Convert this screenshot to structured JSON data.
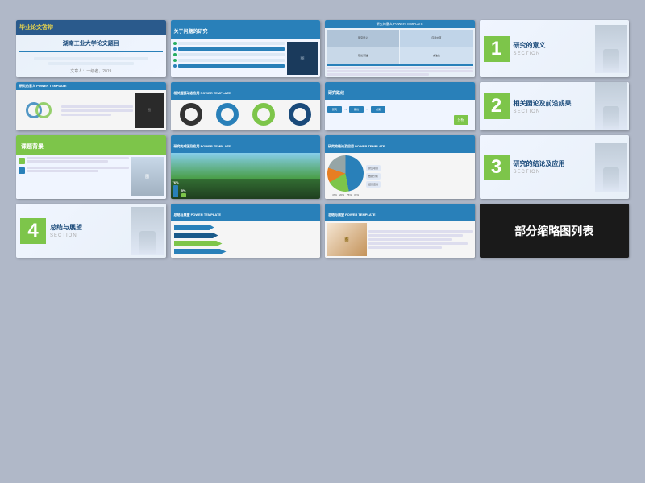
{
  "title": "部分缩略图列表",
  "accent_blue": "#2980b9",
  "accent_green": "#7dc54a",
  "accent_dark": "#1a4a7a",
  "slides": [
    {
      "id": 1,
      "type": "title",
      "title": "毕业论文答辩",
      "subtitle": "湖南工业大学论文题目",
      "info": "文章人：一级者，2019"
    },
    {
      "id": 2,
      "type": "content",
      "header": "关于问题的研究",
      "items": [
        "研究的意义",
        "关于问题的研究",
        "研究的成因及应用",
        "研究路线",
        "研究的结论及应用",
        "POWER TEMPLATE"
      ]
    },
    {
      "id": 3,
      "type": "table",
      "header": "研究的意义 POWER TEMPLATE"
    },
    {
      "id": 4,
      "type": "section",
      "number": "1",
      "title": "研究的意义",
      "label": "SECTION"
    },
    {
      "id": 5,
      "type": "venn",
      "header": "研究的意义 POWER TEMPLATE"
    },
    {
      "id": 6,
      "type": "donuts",
      "header": "相关圆弧动态应用 POWER TEMPLATE",
      "labels": [
        "",
        "",
        ""
      ]
    },
    {
      "id": 7,
      "type": "flowchart",
      "header": "研究路线",
      "items": [
        "分析"
      ]
    },
    {
      "id": 8,
      "type": "section",
      "number": "2",
      "title": "相关圆论及前沿成果",
      "label": "SECTION"
    },
    {
      "id": 9,
      "type": "topic",
      "header": "课题背景"
    },
    {
      "id": 10,
      "type": "cityscape",
      "header": "研究的成因及应用 POWER TEMPLATE",
      "bars": [
        "76%",
        "5%"
      ]
    },
    {
      "id": 11,
      "type": "pie",
      "header": "研究的结论及应用 POWER TEMPLATE",
      "percentages": [
        "47%",
        "20%",
        "75%",
        "33%"
      ]
    },
    {
      "id": 12,
      "type": "section",
      "number": "3",
      "title": "研究的结论及应用",
      "label": "SECTION"
    },
    {
      "id": 13,
      "type": "section",
      "number": "4",
      "title": "总结与展望",
      "label": "SECTION"
    },
    {
      "id": 14,
      "type": "arrows",
      "header": "总结与展望 POWER TEMPLATE"
    },
    {
      "id": 15,
      "type": "photo",
      "header": "总结与展望 POWER TEMPLATE"
    },
    {
      "id": 16,
      "type": "last",
      "label": "部分缩略图列表"
    }
  ]
}
